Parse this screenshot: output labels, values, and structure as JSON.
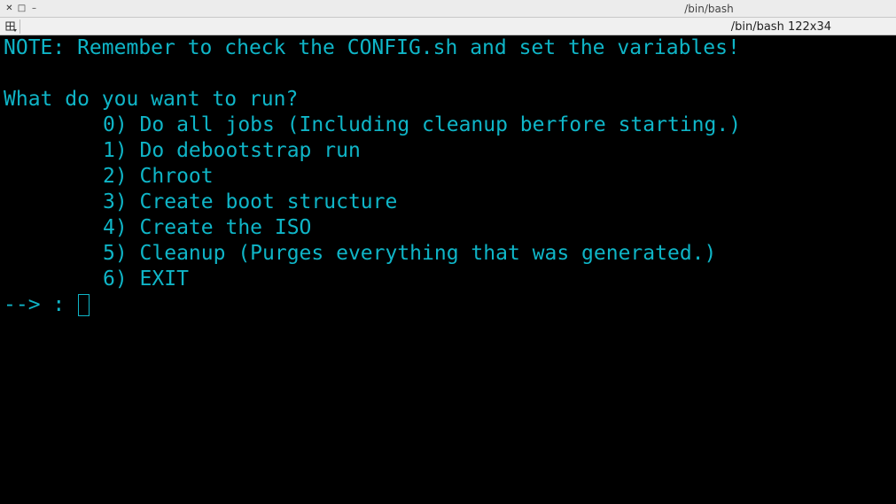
{
  "window": {
    "title": "/bin/bash",
    "buttons": [
      {
        "name": "close-icon",
        "glyph": "✕"
      },
      {
        "name": "maximize-icon",
        "glyph": "□"
      },
      {
        "name": "minimize-icon",
        "glyph": "–"
      }
    ]
  },
  "tab": {
    "label": "/bin/bash 122x34"
  },
  "colors": {
    "terminal_bg": "#000000",
    "terminal_fg": "#0fb5c7"
  },
  "terminal": {
    "note": "NOTE: Remember to check the CONFIG.sh and set the variables!",
    "question": "What do you want to run?",
    "options": [
      "0) Do all jobs (Including cleanup berfore starting.)",
      "1) Do debootstrap run",
      "2) Chroot",
      "3) Create boot structure",
      "4) Create the ISO",
      "5) Cleanup (Purges everything that was generated.)",
      "6) EXIT"
    ],
    "prompt": "--> : "
  }
}
